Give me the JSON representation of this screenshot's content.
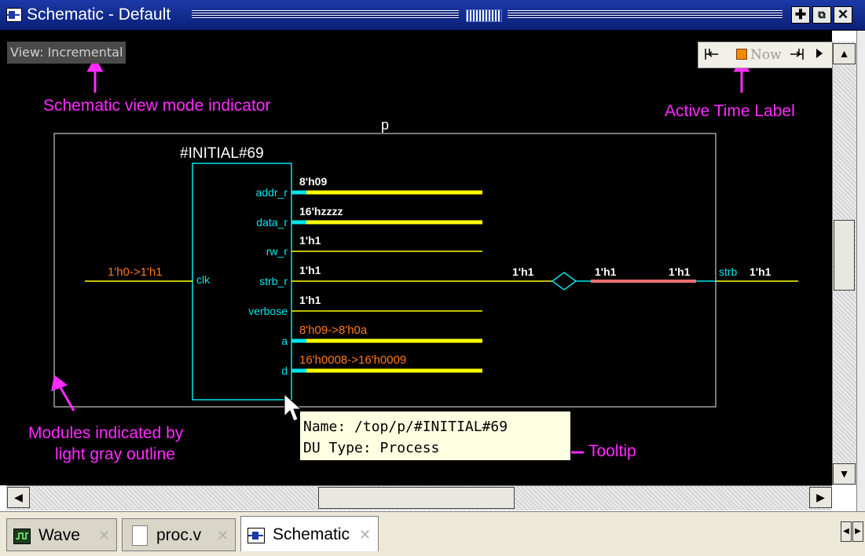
{
  "window": {
    "title": "Schematic - Default",
    "grip": ":::::::",
    "buttons": {
      "dock": "✚",
      "undock": "⧉",
      "close": "✕"
    }
  },
  "view_indicator": "View: Incremental",
  "time_toolbar": {
    "prev_icon": "go-to-previous-time-icon",
    "now_label": "Now",
    "next_icon": "go-to-next-time-icon",
    "expand_icon": "play-arrow-icon"
  },
  "callouts": {
    "view_mode": "Schematic view mode indicator",
    "active_time": "Active Time Label",
    "modules_line1": "Modules indicated by",
    "modules_line2": "light gray outline",
    "tooltip": "Tooltip"
  },
  "schematic": {
    "module_name": "p",
    "process_name": "#INITIAL#69",
    "input_value": "1'h0->1'h1",
    "input_port": "clk",
    "ports": [
      {
        "name": "addr_r",
        "value": "8'h09",
        "changed": false
      },
      {
        "name": "data_r",
        "value": "16'hzzzz",
        "changed": false
      },
      {
        "name": "rw_r",
        "value": "1'h1",
        "changed": false
      },
      {
        "name": "strb_r",
        "value": "1'h1",
        "changed": false
      },
      {
        "name": "verbose",
        "value": "1'h1",
        "changed": false
      },
      {
        "name": "a",
        "value": "8'h09->8'h0a",
        "changed": true
      },
      {
        "name": "d",
        "value": "16'h0008->16'h0009",
        "changed": true
      }
    ],
    "strb_chain_values": [
      "1'h1",
      "1'h1",
      "1'h1"
    ],
    "output_port": "strb",
    "output_value": "1'h1",
    "colors": {
      "background": "#000000",
      "wire": "#ffff00",
      "port": "#00e5ee",
      "changed_value": "#ff7a1a",
      "highlight_wire": "#f07070",
      "module_outline": "#a0a0a0",
      "annotation": "#ff2bff"
    }
  },
  "tooltip": {
    "line1": "Name: /top/p/#INITIAL#69",
    "line2": "DU Type: Process"
  },
  "scrollbars": {
    "up": "▲",
    "down": "▼",
    "left": "◀",
    "right": "▶"
  },
  "tabs": [
    {
      "label": "Wave",
      "icon": "wave-icon",
      "active": false
    },
    {
      "label": "proc.v",
      "icon": "file-icon",
      "active": false
    },
    {
      "label": "Schematic",
      "icon": "schematic-icon",
      "active": true
    }
  ],
  "tab_close": "✕",
  "tab_nav": {
    "prev": "◀",
    "next": "▶"
  }
}
